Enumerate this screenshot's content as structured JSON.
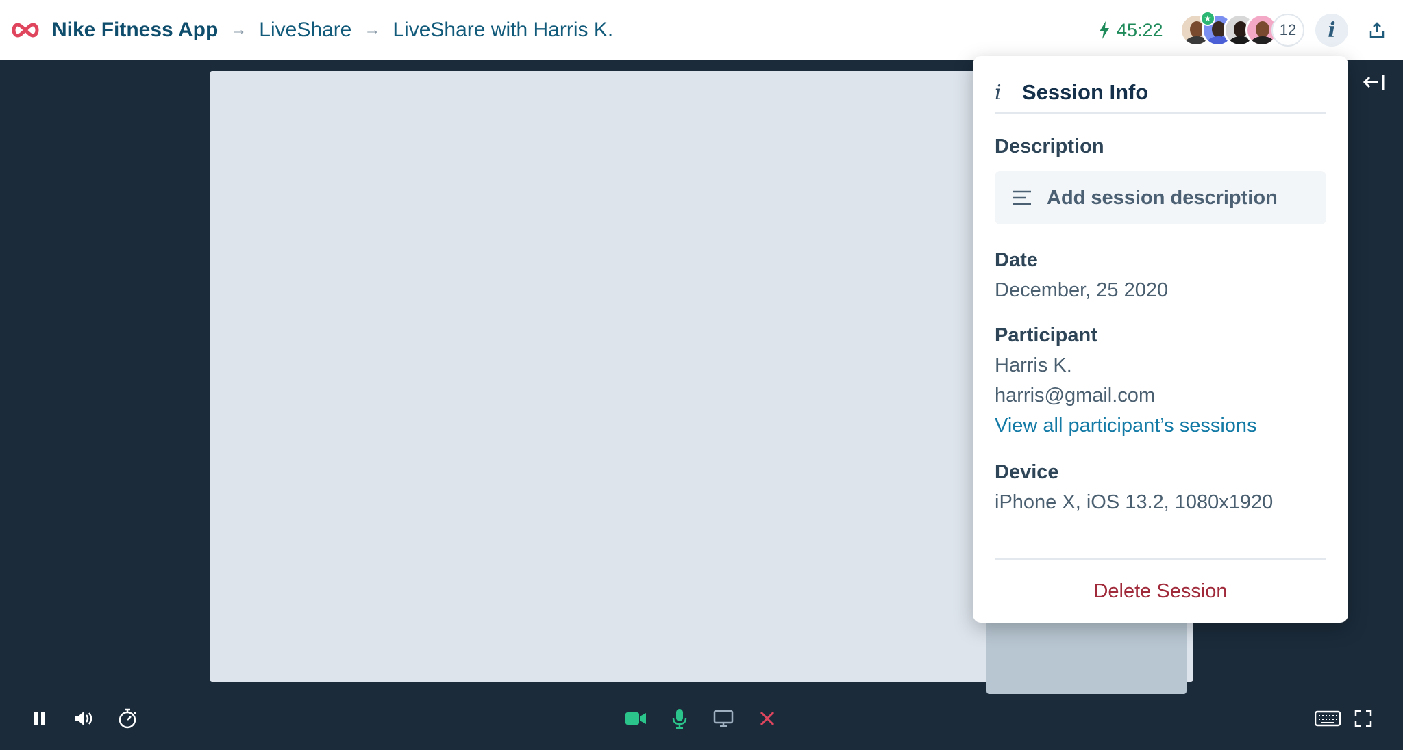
{
  "header": {
    "app_name": "Nike Fitness App",
    "breadcrumb": [
      "LiveShare",
      "LiveShare with Harris K."
    ],
    "separator": "→",
    "timer": "45:22",
    "participant_count": "12",
    "info_glyph": "i"
  },
  "panel": {
    "icon_glyph": "i",
    "title": "Session Info",
    "description_label": "Description",
    "description_placeholder": "Add session description",
    "date_label": "Date",
    "date_value": "December, 25 2020",
    "participant_label": "Participant",
    "participant_name": "Harris K.",
    "participant_email": "harris@gmail.com",
    "participant_link": "View all participant’s sessions",
    "device_label": "Device",
    "device_value": "iPhone X, iOS 13.2, 1080x1920",
    "delete_label": "Delete Session"
  },
  "colors": {
    "brand_logo": "#e0455e",
    "accent_green": "#2bc48a",
    "danger": "#e0455e",
    "dark_bg": "#1b2b3a",
    "link": "#137aa6"
  },
  "icons": [
    "infinity-logo",
    "bolt-icon",
    "info-icon",
    "share-icon",
    "collapse-panel-icon",
    "lines-icon",
    "pause-icon",
    "volume-icon",
    "stopwatch-icon",
    "video-camera-icon",
    "microphone-icon",
    "screen-share-icon",
    "close-icon",
    "keyboard-icon",
    "fullscreen-icon"
  ]
}
